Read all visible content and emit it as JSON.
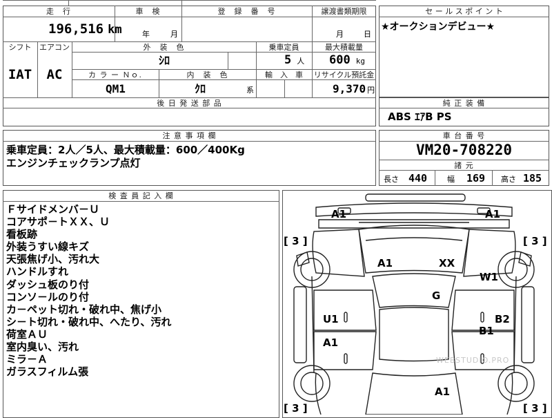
{
  "mileage": {
    "header": "走　行",
    "value": "196,516",
    "unit": "km"
  },
  "inspection": {
    "header": "車　検",
    "year_label": "年",
    "month_label": "月"
  },
  "registration": {
    "header": "登　録　番　号"
  },
  "transfer": {
    "header": "譲渡書類期限",
    "month_label": "月",
    "day_label": "日"
  },
  "sales_point": {
    "header": "セ ー ル ス ポ イ ン ト",
    "text": "★オークションデビュー★"
  },
  "shift": {
    "header": "シフト",
    "value": "IAT"
  },
  "aircon": {
    "header": "エアコン",
    "value": "AC"
  },
  "exterior_color": {
    "header": "外　装　色",
    "value": "ｼﾛ"
  },
  "capacity": {
    "header": "乗車定員",
    "value": "5",
    "unit": "人"
  },
  "max_load": {
    "header": "最大積載量",
    "value": "600",
    "unit": "kg"
  },
  "color_no": {
    "header": "カ ラ ー Ｎｏ.",
    "value": "QM1"
  },
  "interior_color": {
    "header": "内　装　色",
    "value": "ｸﾛ",
    "suffix": "系"
  },
  "import": {
    "header": "輸　入　車"
  },
  "recycle": {
    "header": "リサイクル預託金",
    "value": "9,370",
    "unit": "円"
  },
  "later_parts": {
    "header": "後 日 発 送 部 品"
  },
  "genuine_equipment": {
    "header": "純 正 装 備",
    "value": "ABS ｴｱB PS"
  },
  "notes": {
    "header": "注 意 事 項 欄",
    "lines": [
      "乗車定員：2人／5人、最大積載量：600／400Kg",
      "エンジンチェックランプ点灯"
    ]
  },
  "chassis": {
    "header": "車 台 番 号",
    "value": "VM20-708220"
  },
  "specs": {
    "header": "諸 元",
    "length_label": "長さ",
    "length": "440",
    "width_label": "幅",
    "width": "169",
    "height_label": "高さ",
    "height": "185"
  },
  "inspector": {
    "header": "検 査 員 記 入 欄",
    "lines": [
      "Ｆサイドメンバ－Ｕ",
      "コアサポ－トＸＸ、Ｕ",
      "看板跡",
      "外装うすい線キズ",
      "天張焦げ小、汚れ大",
      "ハンドルすれ",
      "ダッシュ板のり付",
      "コンソ－ルのり付",
      "カ－ペット切れ・破れ中、焦げ小",
      "シ－ト切れ・破れ中、へたり、汚れ",
      "荷室ＡＵ",
      "室内臭い、汚れ",
      "ミラ－Ａ",
      "ガラスフィルム張"
    ]
  },
  "diagram": {
    "tires": {
      "fl": "[ 3 ]",
      "fr": "[ 3 ]",
      "rl": "[ 3 ]",
      "rr": "[ 3 ]"
    },
    "marks": {
      "front_left": "A1",
      "front_right": "A1",
      "hood_left": "A1",
      "hood_right": "XX",
      "fender_right": "W1",
      "windshield": "G",
      "door_fl": "U1",
      "door_fr": "B2",
      "door_fr2": "B1",
      "door_rl": "A1",
      "rear": "A1"
    },
    "watermark": "WEBSTUDIO.PRO"
  }
}
